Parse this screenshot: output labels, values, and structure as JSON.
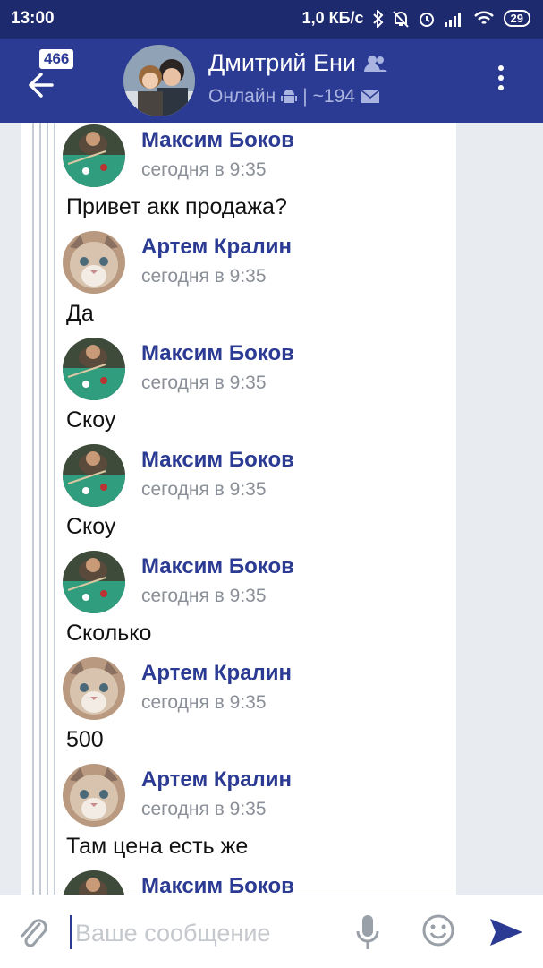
{
  "status_bar": {
    "time": "13:00",
    "network_speed": "1,0 КБ/с",
    "battery": "29"
  },
  "header": {
    "unread_badge": "466",
    "chat_title": "Дмитрий Ени",
    "status": "Онлайн",
    "separator": "|",
    "message_count": "~194",
    "icons": [
      "back-arrow-icon",
      "group-icon",
      "android-icon",
      "envelope-icon",
      "more-vert-icon"
    ]
  },
  "messages": [
    {
      "author": "Максим Боков",
      "time": "сегодня в 9:35",
      "text": "Привет акк продажа?",
      "avatar": "billiards"
    },
    {
      "author": "Артем Кралин",
      "time": "сегодня в 9:35",
      "text": "Да",
      "avatar": "cat"
    },
    {
      "author": "Максим Боков",
      "time": "сегодня в 9:35",
      "text": "Скоу",
      "avatar": "billiards"
    },
    {
      "author": "Максим Боков",
      "time": "сегодня в 9:35",
      "text": "Скоу",
      "avatar": "billiards"
    },
    {
      "author": "Максим Боков",
      "time": "сегодня в 9:35",
      "text": "Сколько",
      "avatar": "billiards"
    },
    {
      "author": "Артем Кралин",
      "time": "сегодня в 9:35",
      "text": "500",
      "avatar": "cat"
    },
    {
      "author": "Артем Кралин",
      "time": "сегодня в 9:35",
      "text": "Там цена есть же",
      "avatar": "cat"
    },
    {
      "author": "Максим Боков",
      "time": "",
      "text": "",
      "avatar": "billiards"
    }
  ],
  "composer": {
    "placeholder": "Ваше сообщение",
    "value": "",
    "icons": [
      "paperclip-icon",
      "microphone-icon",
      "emoji-icon",
      "send-icon"
    ]
  },
  "colors": {
    "status_bar": "#1e2a6e",
    "header": "#2b3a92",
    "author_name": "#2b3a92",
    "timestamp": "#8a8f98"
  }
}
